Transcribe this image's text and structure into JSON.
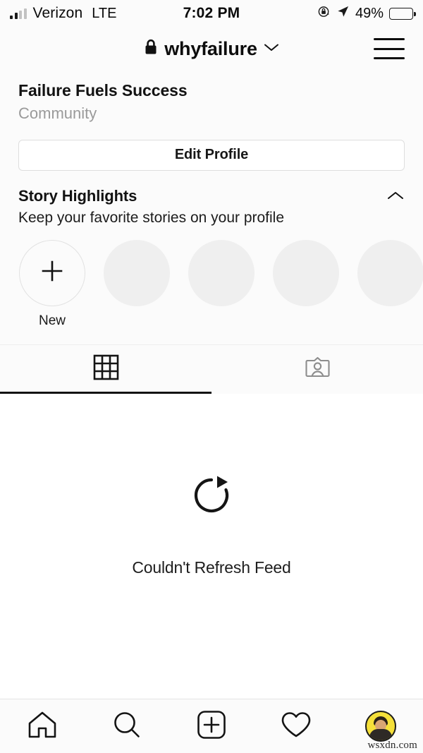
{
  "status_bar": {
    "carrier": "Verizon",
    "network": "LTE",
    "time": "7:02 PM",
    "battery_percent": "49%",
    "battery_level": 49,
    "rotation_lock_icon": "rotation-lock-icon",
    "location_icon": "location-arrow-icon"
  },
  "header": {
    "username": "whyfailure",
    "lock_icon": "lock-icon",
    "dropdown_icon": "chevron-down-icon",
    "menu_icon": "hamburger-menu-icon"
  },
  "profile": {
    "full_name": "Failure Fuels Success",
    "category": "Community",
    "edit_profile_label": "Edit Profile"
  },
  "highlights": {
    "title": "Story Highlights",
    "subtitle": "Keep your favorite stories on your profile",
    "collapse_icon": "chevron-up-icon",
    "new_label": "New",
    "new_icon": "plus-icon",
    "placeholder_count": 4,
    "placeholder_color": "#efefef"
  },
  "tabs": [
    {
      "name": "grid",
      "icon": "grid-icon",
      "active": true
    },
    {
      "name": "tagged",
      "icon": "person-card-icon",
      "active": false
    }
  ],
  "feed": {
    "refresh_icon": "refresh-icon",
    "message": "Couldn't Refresh Feed"
  },
  "bottom_nav": [
    {
      "name": "home",
      "icon": "home-icon"
    },
    {
      "name": "search",
      "icon": "search-icon"
    },
    {
      "name": "create",
      "icon": "plus-square-icon"
    },
    {
      "name": "activity",
      "icon": "heart-icon"
    },
    {
      "name": "profile",
      "icon": "avatar-icon"
    }
  ],
  "watermark": "wsxdn.com",
  "colors": {
    "background": "#fbfbfb",
    "feed_background": "#ffffff",
    "text_primary": "#121212",
    "text_muted": "#9a9a9a",
    "avatar_background": "#f5e03a"
  }
}
